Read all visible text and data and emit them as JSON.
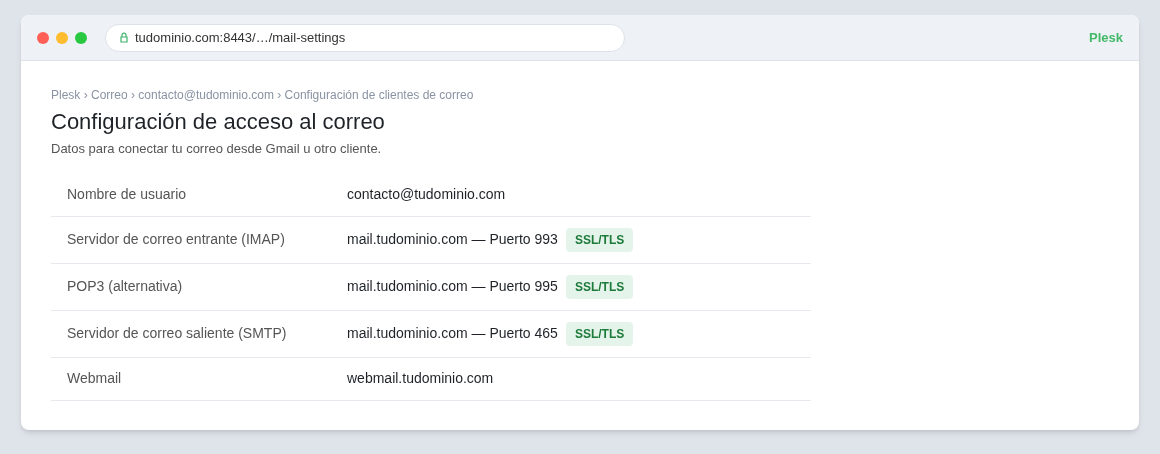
{
  "browser": {
    "url": "tudominio.com:8443/…/mail-settings",
    "brand": "Plesk"
  },
  "breadcrumb": "Plesk › Correo › contacto@tudominio.com › Configuración de clientes de correo",
  "title": "Configuración de acceso al correo",
  "subtitle": "Datos para conectar tu correo desde Gmail u otro cliente.",
  "rows": [
    {
      "label": "Nombre de usuario",
      "value": "contacto@tudominio.com"
    },
    {
      "label": "Servidor de correo entrante (IMAP)",
      "value": "mail.tudominio.com — Puerto 993",
      "badge": "SSL/TLS"
    },
    {
      "label": "POP3 (alternativa)",
      "value": "mail.tudominio.com — Puerto 995",
      "badge": "SSL/TLS"
    },
    {
      "label": "Servidor de correo saliente (SMTP)",
      "value": "mail.tudominio.com — Puerto 465",
      "badge": "SSL/TLS"
    },
    {
      "label": "Webmail",
      "value": "webmail.tudominio.com"
    }
  ]
}
